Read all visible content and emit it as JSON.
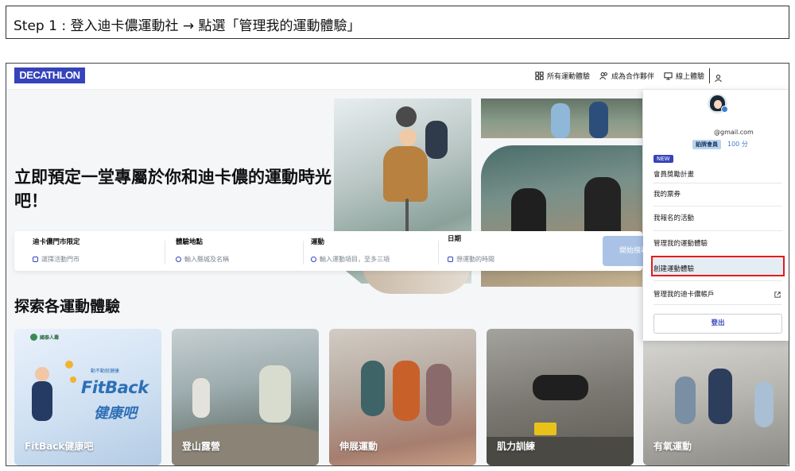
{
  "step": {
    "text": "Step 1 : 登入迪卡儂運動社 → 點選「管理我的運動體驗」"
  },
  "nav": {
    "logo": "DECATHLON",
    "all_experiences": "所有運動體驗",
    "become_partner": "成為合作夥伴",
    "online_experience": "線上體驗"
  },
  "hero": {
    "title": "立即預定一堂專屬於你和迪卡儂的運動時光吧！"
  },
  "search": {
    "store": {
      "label": "迪卡儂門市限定",
      "placeholder": "選擇活動門市"
    },
    "location": {
      "label": "體驗地點",
      "placeholder": "輸入縣城及名稱"
    },
    "sport": {
      "label": "運動",
      "placeholder": "輸入運動項目，至多三項"
    },
    "date": {
      "label": "日期",
      "placeholder": "想運動的時間"
    },
    "button": "開始搜尋"
  },
  "section": {
    "title": "探索各運動體驗"
  },
  "cards": [
    {
      "label": "FitBack健康吧"
    },
    {
      "label": "登山露營"
    },
    {
      "label": "伸展運動"
    },
    {
      "label": "肌力訓練"
    },
    {
      "label": "有氧運動"
    }
  ],
  "fitback": {
    "sponsor": "國泰人壽",
    "sub": "動不動就健康",
    "brand": "FitBack",
    "brand_cn": "健康吧"
  },
  "dropdown": {
    "email": "@gmail.com",
    "tier": "鉑牌會員",
    "points": "100 分",
    "new_badge": "NEW",
    "items": [
      {
        "label": "會員獎勵計畫"
      },
      {
        "label": "我的票券"
      },
      {
        "label": "我報名的活動"
      },
      {
        "label": "管理我的運動體驗"
      },
      {
        "label": "創建運動體驗"
      },
      {
        "label": "管理我的迪卡儂帳戶"
      }
    ],
    "logout": "登出"
  },
  "colors": {
    "brand": "#3643ba",
    "highlight_border": "#e31b1b",
    "points": "#3c7bd1"
  }
}
